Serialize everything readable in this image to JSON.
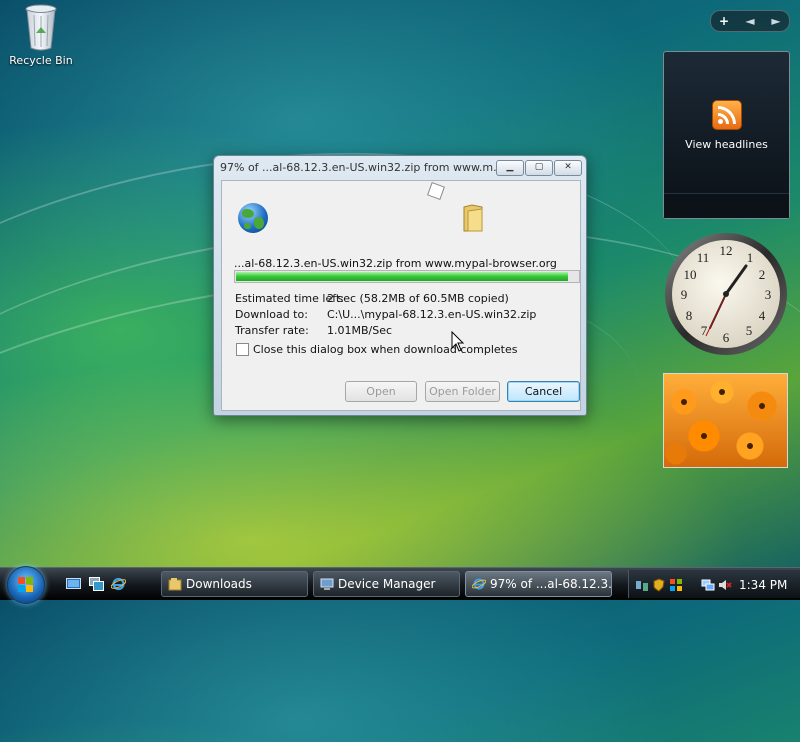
{
  "desktop": {
    "recycle_bin_label": "Recycle Bin"
  },
  "sidebar": {
    "controls": {
      "add": "+",
      "prev": "◄",
      "next": "►"
    },
    "feed_gadget": {
      "label": "View headlines"
    }
  },
  "dialog": {
    "title": "97% of ...al-68.12.3.en-US.win32.zip from www.m...",
    "controls": {
      "minimize": "▁",
      "maximize": "▢",
      "close": "✕"
    },
    "filename_line": "...al-68.12.3.en-US.win32.zip from www.mypal-browser.org",
    "progress": 0.97,
    "fields": {
      "estimated_label": "Estimated time left:",
      "estimated_value": "2 sec (58.2MB of 60.5MB copied)",
      "download_to_label": "Download to:",
      "download_to_value": "C:\\U...\\mypal-68.12.3.en-US.win32.zip",
      "transfer_label": "Transfer rate:",
      "transfer_value": "1.01MB/Sec"
    },
    "close_checkbox_label": "Close this dialog box when download completes",
    "close_checkbox_checked": false,
    "buttons": {
      "open": "Open",
      "open_folder": "Open Folder",
      "cancel": "Cancel"
    }
  },
  "taskbar": {
    "tasks": [
      {
        "label": "Downloads",
        "icon": "folder-icon"
      },
      {
        "label": "Device Manager",
        "icon": "device-manager-icon"
      },
      {
        "label": "97% of ...al-68.12.3...",
        "icon": "ie-icon"
      }
    ],
    "clock": "1:34 PM"
  },
  "colors": {
    "progress_fill": "#37c63a",
    "cancel_button_border": "#3c7fb1"
  }
}
